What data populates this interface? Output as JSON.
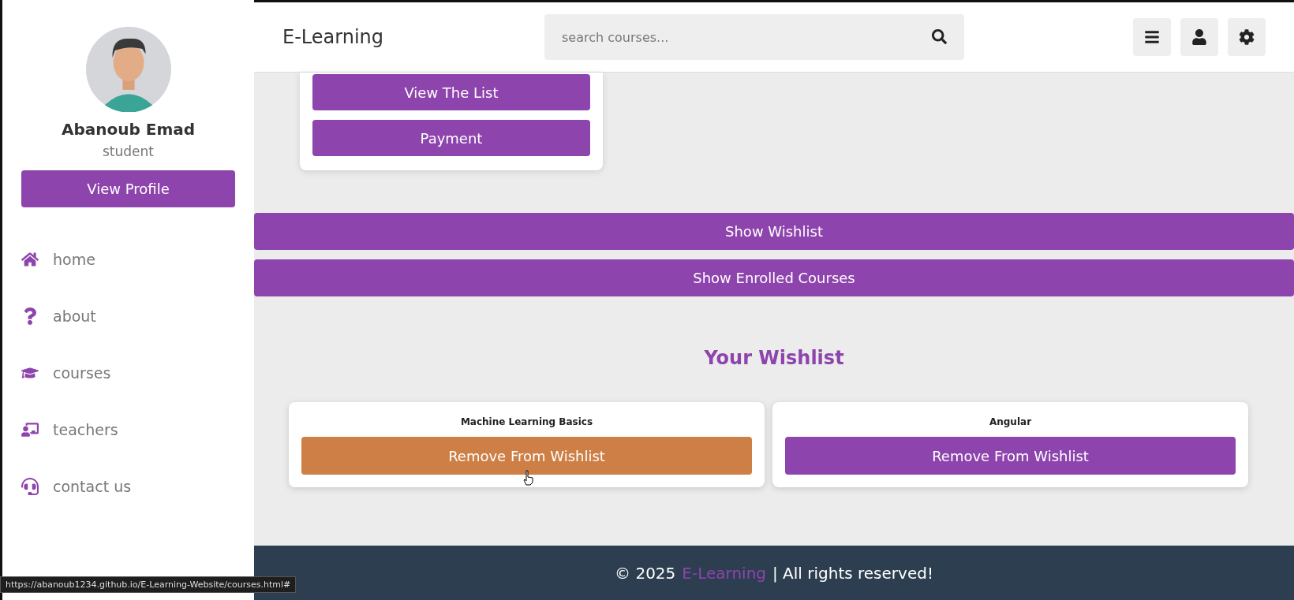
{
  "sidebar": {
    "user": {
      "name": "Abanoub Emad",
      "role": "student"
    },
    "profile_button": "View Profile",
    "items": [
      {
        "kind": "home",
        "label": "home"
      },
      {
        "kind": "about",
        "label": "about"
      },
      {
        "kind": "courses",
        "label": "courses"
      },
      {
        "kind": "teachers",
        "label": "teachers"
      },
      {
        "kind": "contact",
        "label": "contact us"
      }
    ]
  },
  "header": {
    "brand": "E-Learning",
    "search": {
      "placeholder": "search courses..."
    }
  },
  "top_card": {
    "buttons": [
      "View The List",
      "Payment"
    ]
  },
  "actions": [
    "Show Wishlist",
    "Show Enrolled Courses"
  ],
  "wishlist": {
    "title": "Your Wishlist",
    "items": [
      {
        "title": "Machine Learning Basics",
        "button": "Remove From Wishlist",
        "hovered": true
      },
      {
        "title": "Angular",
        "button": "Remove From Wishlist",
        "hovered": false
      }
    ]
  },
  "footer": {
    "copyright": "© 2025",
    "brand": "E-Learning",
    "rights": "| All rights reserved!"
  },
  "status_url": "https://abanoub1234.github.io/E-Learning-Website/courses.html#"
}
